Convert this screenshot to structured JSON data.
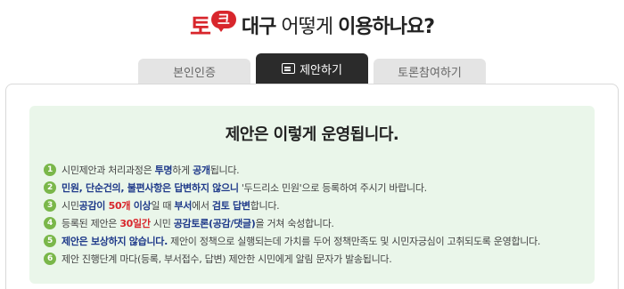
{
  "header": {
    "logo_to": "토",
    "logo_bubble": "크",
    "title_part1": "대구",
    "title_part2": " 어떻게 ",
    "title_part3": "이용하나요?"
  },
  "tabs": [
    {
      "label": "본인인증",
      "active": false
    },
    {
      "label": "제안하기",
      "active": true
    },
    {
      "label": "토론참여하기",
      "active": false
    }
  ],
  "notice": {
    "title": "제안은 이렇게 운영됩니다.",
    "items": [
      {
        "num": "1",
        "segments": [
          {
            "t": "시민제안과 처리과정은 "
          },
          {
            "t": "투명",
            "s": "blue"
          },
          {
            "t": "하게 "
          },
          {
            "t": "공개",
            "s": "blue"
          },
          {
            "t": "됩니다."
          }
        ]
      },
      {
        "num": "2",
        "segments": [
          {
            "t": "민원, 단순건의, 불편사항은 답변하지 않으니",
            "s": "blue"
          },
          {
            "t": " '두드리소 민원'으로 등록하여 주시기 바랍니다."
          }
        ]
      },
      {
        "num": "3",
        "segments": [
          {
            "t": "시민"
          },
          {
            "t": "공감이 ",
            "s": "blue"
          },
          {
            "t": "50개",
            "s": "red"
          },
          {
            "t": " 이상",
            "s": "blue"
          },
          {
            "t": "일 때 "
          },
          {
            "t": "부서",
            "s": "blue"
          },
          {
            "t": "에서 "
          },
          {
            "t": "검토 답변",
            "s": "blue"
          },
          {
            "t": "합니다."
          }
        ]
      },
      {
        "num": "4",
        "segments": [
          {
            "t": "등록된 제안은 "
          },
          {
            "t": "30일간",
            "s": "red"
          },
          {
            "t": " 시민 "
          },
          {
            "t": "공감토론(공감/댓글)",
            "s": "blue"
          },
          {
            "t": "을 거쳐 숙성합니다."
          }
        ]
      },
      {
        "num": "5",
        "segments": [
          {
            "t": "제안은 보상하지 않습니다.",
            "s": "blue"
          },
          {
            "t": " 제안이 정책으로 실행되는데 가치를 두어 정책만족도 및 시민자긍심이 고취되도록 운영합니다."
          }
        ]
      },
      {
        "num": "6",
        "segments": [
          {
            "t": "제안 진행단계 마다(등록, 부서접수, 답변) 제안한 시민에게 알림 문자가 발송됩니다."
          }
        ]
      }
    ]
  }
}
